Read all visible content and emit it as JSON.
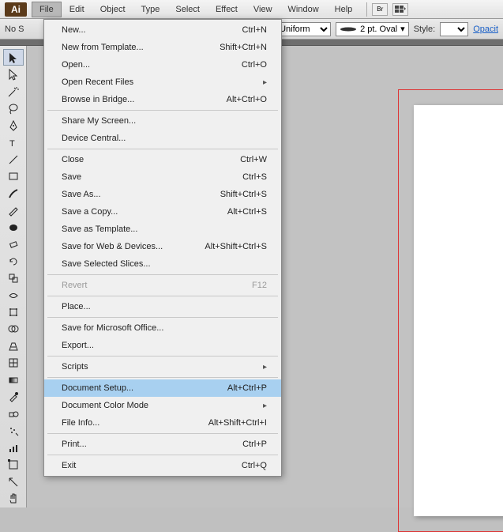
{
  "app": {
    "badge": "Ai"
  },
  "menubar": {
    "items": [
      "File",
      "Edit",
      "Object",
      "Type",
      "Select",
      "Effect",
      "View",
      "Window",
      "Help"
    ],
    "active_index": 0,
    "right": {
      "br": "Br"
    }
  },
  "optbar": {
    "left_label": "No S",
    "uniform": "Uniform",
    "stroke": "2 pt. Oval",
    "style_label": "Style:",
    "style_value": "",
    "opac": "Opacit"
  },
  "dropdown": {
    "groups": [
      [
        {
          "label": "New...",
          "shortcut": "Ctrl+N"
        },
        {
          "label": "New from Template...",
          "shortcut": "Shift+Ctrl+N"
        },
        {
          "label": "Open...",
          "shortcut": "Ctrl+O"
        },
        {
          "label": "Open Recent Files",
          "submenu": true
        },
        {
          "label": "Browse in Bridge...",
          "shortcut": "Alt+Ctrl+O"
        }
      ],
      [
        {
          "label": "Share My Screen..."
        },
        {
          "label": "Device Central..."
        }
      ],
      [
        {
          "label": "Close",
          "shortcut": "Ctrl+W"
        },
        {
          "label": "Save",
          "shortcut": "Ctrl+S"
        },
        {
          "label": "Save As...",
          "shortcut": "Shift+Ctrl+S"
        },
        {
          "label": "Save a Copy...",
          "shortcut": "Alt+Ctrl+S"
        },
        {
          "label": "Save as Template..."
        },
        {
          "label": "Save for Web & Devices...",
          "shortcut": "Alt+Shift+Ctrl+S"
        },
        {
          "label": "Save Selected Slices..."
        }
      ],
      [
        {
          "label": "Revert",
          "shortcut": "F12",
          "disabled": true
        }
      ],
      [
        {
          "label": "Place..."
        }
      ],
      [
        {
          "label": "Save for Microsoft Office..."
        },
        {
          "label": "Export..."
        }
      ],
      [
        {
          "label": "Scripts",
          "submenu": true
        }
      ],
      [
        {
          "label": "Document Setup...",
          "shortcut": "Alt+Ctrl+P",
          "highlight": true
        },
        {
          "label": "Document Color Mode",
          "submenu": true
        },
        {
          "label": "File Info...",
          "shortcut": "Alt+Shift+Ctrl+I"
        }
      ],
      [
        {
          "label": "Print...",
          "shortcut": "Ctrl+P"
        }
      ],
      [
        {
          "label": "Exit",
          "shortcut": "Ctrl+Q"
        }
      ]
    ]
  },
  "tools": [
    "selection",
    "direct-selection",
    "magic-wand",
    "lasso",
    "pen",
    "type",
    "line",
    "rectangle",
    "brush",
    "pencil",
    "blob",
    "eraser",
    "rotate",
    "scale",
    "width",
    "free-transform",
    "shape-builder",
    "perspective",
    "mesh",
    "gradient",
    "eyedropper",
    "blend",
    "symbol-sprayer",
    "graph",
    "artboard",
    "slice",
    "hand"
  ]
}
